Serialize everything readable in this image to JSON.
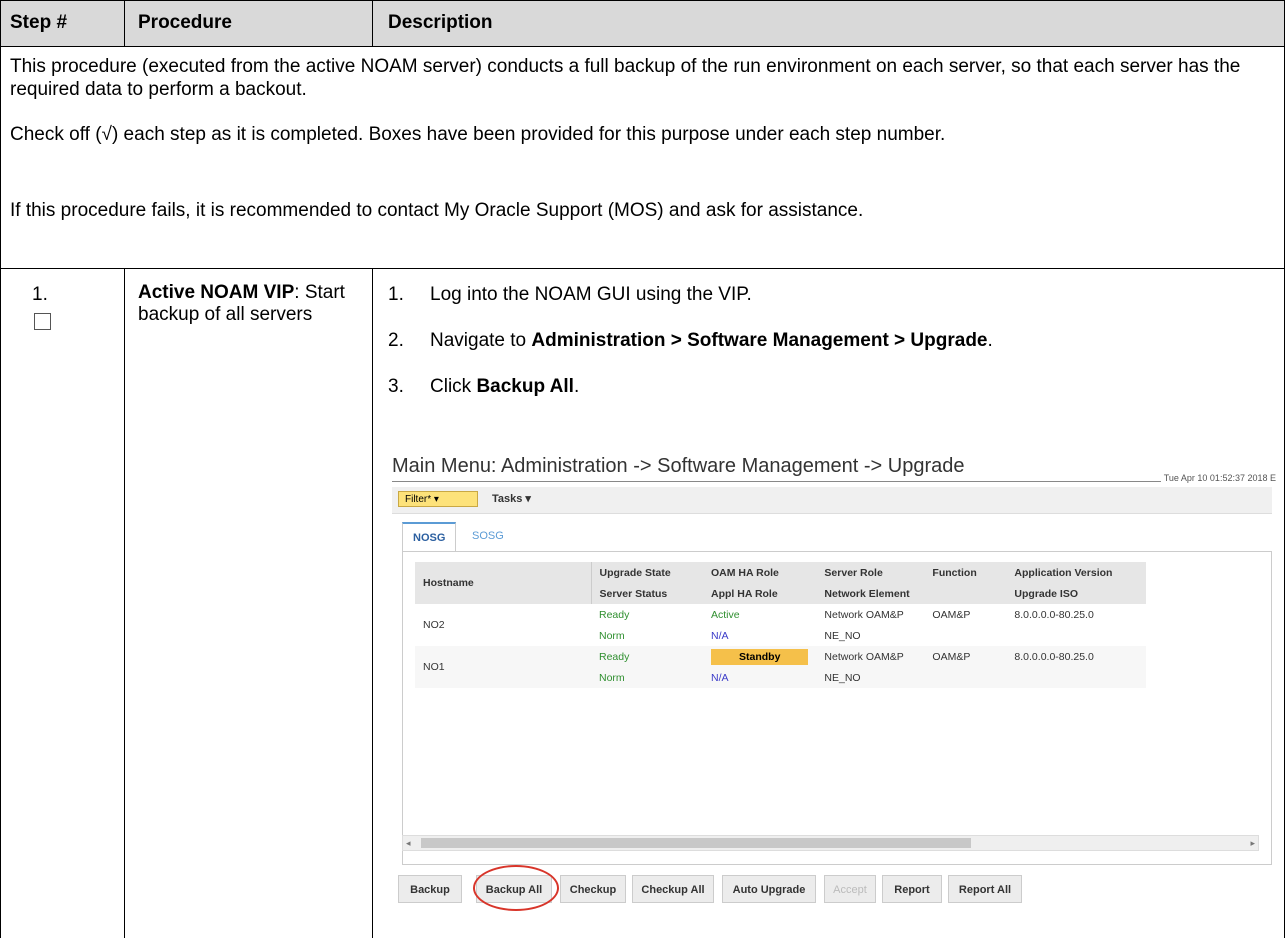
{
  "header": {
    "step": "Step #",
    "procedure": "Procedure",
    "description": "Description"
  },
  "intro": {
    "p1": "This procedure (executed from the active NOAM server) conducts a full backup of the run environment on each server, so that each server has the required data to perform a backout.",
    "p2": "Check off (√) each step as it is completed.  Boxes have been provided for this purpose under each step number.",
    "p3": "If this procedure fails, it is recommended to contact My Oracle Support (MOS) and ask for assistance."
  },
  "step": {
    "number": "1.",
    "procedure_bold": "Active NOAM VIP",
    "procedure_rest": ":  Start backup of all servers",
    "items": [
      {
        "n": "1.",
        "pre": "Log into the NOAM GUI using the VIP.",
        "bold": "",
        "post": ""
      },
      {
        "n": "2.",
        "pre": "Navigate to ",
        "bold": "Administration > Software Management > Upgrade",
        "post": "."
      },
      {
        "n": "3.",
        "pre": "Click ",
        "bold": "Backup All",
        "post": "."
      }
    ]
  },
  "screenshot": {
    "title": "Main Menu: Administration -> Software Management -> Upgrade",
    "timestamp": "Tue Apr 10 01:52:37 2018 E",
    "filter": "Filter* ▾",
    "tasks": "Tasks ▾",
    "tabs": [
      "NOSG",
      "SOSG"
    ],
    "columns_row1": [
      "Hostname",
      "Upgrade State",
      "OAM HA Role",
      "Server Role",
      "Function",
      "Application Version"
    ],
    "columns_row2": [
      "Server Status",
      "Appl HA Role",
      "Network Element",
      "",
      "Upgrade ISO"
    ],
    "rows": [
      {
        "host": "NO2",
        "upgrade_state": "Ready",
        "oam_ha_role": "Active",
        "server_role": "Network OAM&P",
        "function": "OAM&P",
        "app_version": "8.0.0.0.0-80.25.0",
        "server_status": "Norm",
        "appl_ha_role": "N/A",
        "network_element": "NE_NO",
        "upgrade_iso": ""
      },
      {
        "host": "NO1",
        "upgrade_state": "Ready",
        "oam_ha_role": "Standby",
        "server_role": "Network OAM&P",
        "function": "OAM&P",
        "app_version": "8.0.0.0.0-80.25.0",
        "server_status": "Norm",
        "appl_ha_role": "N/A",
        "network_element": "NE_NO",
        "upgrade_iso": ""
      }
    ],
    "buttons": [
      "Backup",
      "Backup All",
      "Checkup",
      "Checkup All",
      "Auto Upgrade",
      "Accept",
      "Report",
      "Report All"
    ],
    "highlight_color": "#d8352a"
  }
}
